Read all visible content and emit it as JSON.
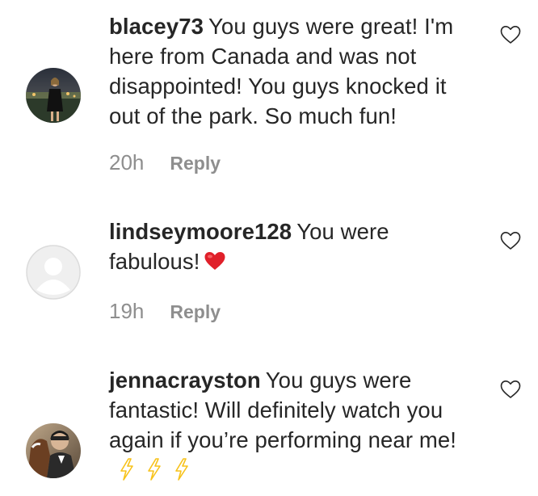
{
  "comments": [
    {
      "username": "blacey73",
      "text": "You guys were great! I'm here from Canada and was not disappointed! You guys knocked it out of the park. So much fun!",
      "time": "20h",
      "reply": "Reply",
      "avatar": "profile-photo"
    },
    {
      "username": "lindseymoore128",
      "text": "You were fabulous!",
      "emoji": "red-heart",
      "time": "19h",
      "reply": "Reply",
      "avatar": "default-avatar"
    },
    {
      "username": "jennacrayston",
      "text": "You guys were fantastic! Will definitely watch you again if you’re performing near me!",
      "emoji": "high-voltage x3",
      "avatar": "profile-photo"
    }
  ],
  "icons": {
    "like": "heart-outline-icon"
  },
  "colors": {
    "text": "#262626",
    "secondary": "#8e8e8e",
    "heart_emoji": "#e0202a",
    "bolt_emoji": "#f7c21a"
  }
}
